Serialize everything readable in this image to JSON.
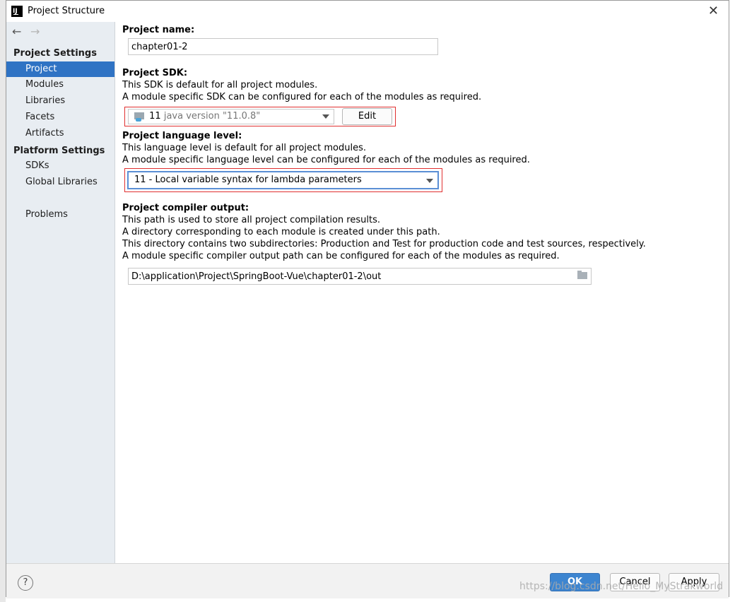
{
  "window": {
    "title": "Project Structure",
    "app_icon_text": "IJ"
  },
  "nav": {
    "back": "←",
    "forward": "→"
  },
  "sidebar": {
    "sections": [
      {
        "heading": "Project Settings",
        "items": [
          {
            "label": "Project"
          },
          {
            "label": "Modules"
          },
          {
            "label": "Libraries"
          },
          {
            "label": "Facets"
          },
          {
            "label": "Artifacts"
          }
        ]
      },
      {
        "heading": "Platform Settings",
        "items": [
          {
            "label": "SDKs"
          },
          {
            "label": "Global Libraries"
          }
        ]
      }
    ],
    "problems": "Problems",
    "active_item": "Project"
  },
  "project_name": {
    "label": "Project name:",
    "value": "chapter01-2"
  },
  "project_sdk": {
    "label": "Project SDK:",
    "desc1": "This SDK is default for all project modules.",
    "desc2": "A module specific SDK can be configured for each of the modules as required.",
    "sdk_number": "11",
    "sdk_version": "java version \"11.0.8\"",
    "edit_label": "Edit"
  },
  "language_level": {
    "label": "Project language level:",
    "desc1": "This language level is default for all project modules.",
    "desc2": "A module specific language level can be configured for each of the modules as required.",
    "value": "11 - Local variable syntax for lambda parameters"
  },
  "compiler_output": {
    "label": "Project compiler output:",
    "desc1": "This path is used to store all project compilation results.",
    "desc2": "A directory corresponding to each module is created under this path.",
    "desc3": "This directory contains two subdirectories: Production and Test for production code and test sources, respectively.",
    "desc4": "A module specific compiler output path can be configured for each of the modules as required.",
    "path": "D:\\application\\Project\\SpringBoot-Vue\\chapter01-2\\out"
  },
  "buttons": {
    "help": "?",
    "ok": "OK",
    "cancel": "Cancel",
    "apply": "Apply"
  },
  "watermark": "https://blog.csdn.net/Hello_MyStrakworld",
  "colors": {
    "selection": "#2f73c4",
    "primary_button": "#3d85d0",
    "highlight_box": "#e03030"
  }
}
